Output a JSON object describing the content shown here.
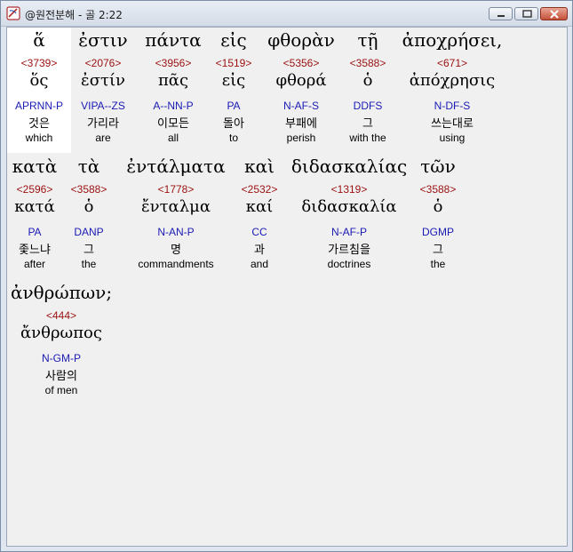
{
  "window": {
    "title": "@원전분해 - 골 2:22"
  },
  "controls": {
    "minimize": "minimize",
    "maximize": "maximize",
    "close": "close"
  },
  "words": [
    {
      "greek": "ἅ",
      "strong": "<3739>",
      "lemma": "ὅς",
      "parse": "APRNN-P",
      "korean": "것은",
      "english": "which"
    },
    {
      "greek": "ἐστιν",
      "strong": "<2076>",
      "lemma": "ἐστίν",
      "parse": "VIPA--ZS",
      "korean": "가리라",
      "english": "are"
    },
    {
      "greek": "πάντα",
      "strong": "<3956>",
      "lemma": "πᾶς",
      "parse": "A--NN-P",
      "korean": "이모든",
      "english": "all"
    },
    {
      "greek": "εἰς",
      "strong": "<1519>",
      "lemma": "εἰς",
      "parse": "PA",
      "korean": "돌아",
      "english": "to"
    },
    {
      "greek": "φθορὰν",
      "strong": "<5356>",
      "lemma": "φθορά",
      "parse": "N-AF-S",
      "korean": "부패에",
      "english": "perish"
    },
    {
      "greek": "τῇ",
      "strong": "<3588>",
      "lemma": "ὁ",
      "parse": "DDFS",
      "korean": "그",
      "english": "with the"
    },
    {
      "greek": "ἀποχρήσει,",
      "strong": "<671>",
      "lemma": "ἀπόχρησις",
      "parse": "N-DF-S",
      "korean": "쓰는대로",
      "english": "using"
    },
    {
      "greek": "κατὰ",
      "strong": "<2596>",
      "lemma": "κατά",
      "parse": "PA",
      "korean": "좇느냐",
      "english": "after"
    },
    {
      "greek": "τὰ",
      "strong": "<3588>",
      "lemma": "ὁ",
      "parse": "DANP",
      "korean": "그",
      "english": "the"
    },
    {
      "greek": "ἐντάλματα",
      "strong": "<1778>",
      "lemma": "ἔνταλμα",
      "parse": "N-AN-P",
      "korean": "명",
      "english": "commandments"
    },
    {
      "greek": "καὶ",
      "strong": "<2532>",
      "lemma": "καί",
      "parse": "CC",
      "korean": "과",
      "english": "and"
    },
    {
      "greek": "διδασκαλίας",
      "strong": "<1319>",
      "lemma": "διδασκαλία",
      "parse": "N-AF-P",
      "korean": "가르침을",
      "english": "doctrines"
    },
    {
      "greek": "τῶν",
      "strong": "<3588>",
      "lemma": "ὁ",
      "parse": "DGMP",
      "korean": "그",
      "english": "the"
    },
    {
      "greek": "ἀνθρώπων;",
      "strong": "<444>",
      "lemma": "ἄνθρωπος",
      "parse": "N-GM-P",
      "korean": "사람의",
      "english": "of men"
    }
  ]
}
